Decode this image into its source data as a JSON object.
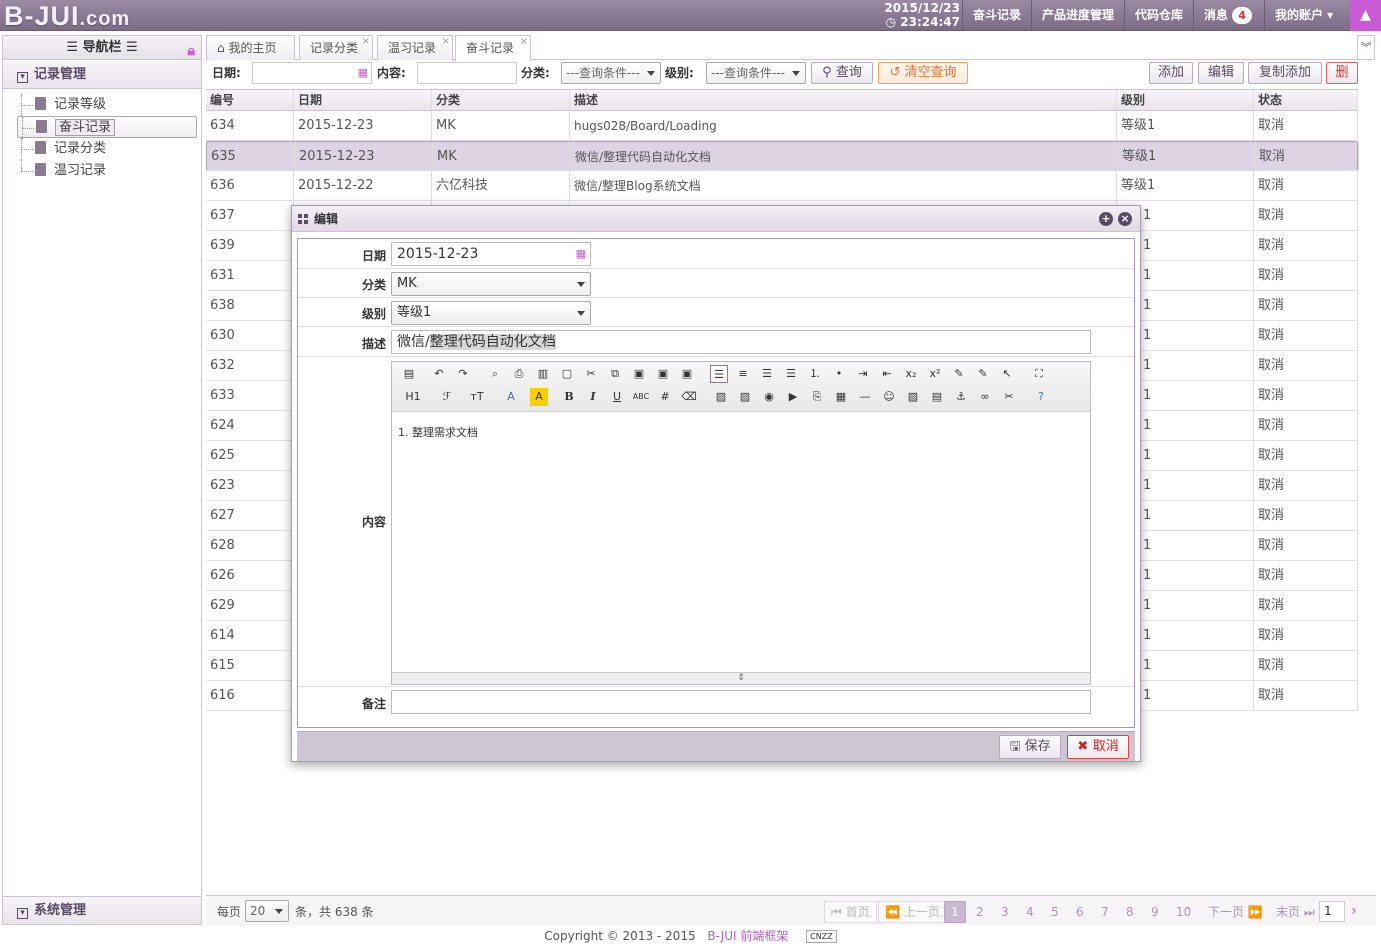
{
  "header": {
    "logo": "B-JUI",
    "logo_suffix": ".com",
    "date": "2015/12/23",
    "time": "◷ 23:24:47",
    "nav": [
      "奋斗记录",
      "产品进度管理",
      "代码仓库"
    ],
    "messages_label": "消息",
    "messages_count": "4",
    "account_label": "我的账户 ▾"
  },
  "sidebar": {
    "title": "☰ 导航栏 ☰",
    "group1": "记录管理",
    "items": [
      "记录等级",
      "奋斗记录",
      "记录分类",
      "温习记录"
    ],
    "group2": "系统管理"
  },
  "tabs": [
    "我的主页",
    "记录分类",
    "温习记录",
    "奋斗记录"
  ],
  "query": {
    "date_label": "日期:",
    "content_label": "内容:",
    "category_label": "分类:",
    "category_value": "---查询条件---",
    "level_label": "级别:",
    "level_value": "---查询条件---",
    "search_btn": "查询",
    "clear_btn": "清空查询",
    "add_btn": "添加",
    "edit_btn": "编辑",
    "copy_add_btn": "复制添加",
    "delete_btn": "删"
  },
  "grid": {
    "columns": [
      "编号",
      "日期",
      "分类",
      "描述",
      "级别",
      "状态"
    ],
    "rows": [
      [
        "634",
        "2015-12-23",
        "MK",
        "hugs028/Board/Loading",
        "等级1",
        "取消"
      ],
      [
        "635",
        "2015-12-23",
        "MK",
        "微信/整理代码自动化文档",
        "等级1",
        "取消"
      ],
      [
        "636",
        "2015-12-22",
        "六亿科技",
        "微信/整理Blog系统文档",
        "等级1",
        "取消"
      ],
      [
        "637",
        "",
        "",
        "",
        "1",
        "取消"
      ],
      [
        "639",
        "",
        "",
        "",
        "1",
        "取消"
      ],
      [
        "631",
        "",
        "",
        "",
        "1",
        "取消"
      ],
      [
        "638",
        "",
        "",
        "",
        "1",
        "取消"
      ],
      [
        "630",
        "",
        "",
        "",
        "1",
        "取消"
      ],
      [
        "632",
        "",
        "",
        "",
        "1",
        "取消"
      ],
      [
        "633",
        "",
        "",
        "",
        "1",
        "取消"
      ],
      [
        "624",
        "",
        "",
        "",
        "1",
        "取消"
      ],
      [
        "625",
        "",
        "",
        "",
        "1",
        "取消"
      ],
      [
        "623",
        "",
        "",
        "",
        "1",
        "取消"
      ],
      [
        "627",
        "",
        "",
        "",
        "1",
        "取消"
      ],
      [
        "628",
        "",
        "",
        "",
        "1",
        "取消"
      ],
      [
        "626",
        "",
        "",
        "",
        "1",
        "取消"
      ],
      [
        "629",
        "",
        "",
        "",
        "1",
        "取消"
      ],
      [
        "614",
        "",
        "",
        "",
        "1",
        "取消"
      ],
      [
        "615",
        "",
        "",
        "",
        "1",
        "取消"
      ],
      [
        "616",
        "",
        "",
        "",
        "1",
        "取消"
      ]
    ]
  },
  "pager": {
    "per_page_label": "每页",
    "per_page": "20",
    "total": "条，共 638 条",
    "first": "⏮ 首页",
    "prev": "⏪ 上一页",
    "pages": [
      "1",
      "2",
      "3",
      "4",
      "5",
      "6",
      "7",
      "8",
      "9",
      "10"
    ],
    "next": "下一页 ⏩",
    "last": "末页 ⏭",
    "jump": "1"
  },
  "footer": {
    "copyright": "Copyright © 2013 - 2015",
    "brand": "B-JUI 前端框架",
    "badge": "CNZZ"
  },
  "dialog": {
    "title": "编辑",
    "date_label": "日期",
    "date_value": "2015-12-23",
    "category_label": "分类",
    "category_value": "MK",
    "level_label": "级别",
    "level_value": "等级1",
    "desc_label": "描述",
    "desc_prefix": "微信/",
    "desc_selected": "整理代码自动化文档",
    "content_label": "内容",
    "content_text": "1. 整理需求文档",
    "remark_label": "备注",
    "save_btn": "保存",
    "cancel_btn": "取消",
    "toolbar_row2_labels": [
      "H1",
      "ℱ",
      "тT",
      "A",
      "A",
      "B",
      "I",
      "U",
      "ABC"
    ]
  }
}
